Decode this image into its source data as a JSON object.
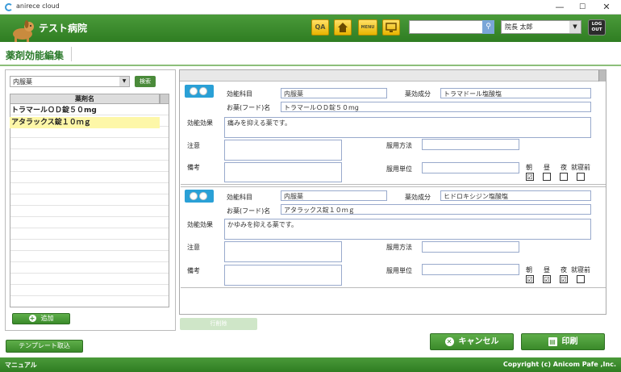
{
  "window": {
    "title": "anirece cloud",
    "minimize": "—",
    "maximize": "☐",
    "close": "✕"
  },
  "header": {
    "hospital_name": "テスト病院",
    "qa_label": "QA",
    "home_icon": "home-icon",
    "menu_label": "MENU",
    "monitor_icon": "monitor-icon",
    "search_value": "",
    "user_name": "院長 太郎",
    "logout_label_1": "LOG",
    "logout_label_2": "OUT"
  },
  "page": {
    "title": "薬剤効能編集"
  },
  "left": {
    "kind_value": "内服薬",
    "search_button": "検索",
    "column_header": "薬剤名",
    "items": [
      {
        "label": "トラマールＯＤ錠５０mg",
        "selected": false
      },
      {
        "label": "アタラックス錠１０ｍｇ",
        "selected": true
      }
    ],
    "add_button": "追加",
    "template_button": "テンプレート取込"
  },
  "labels": {
    "subject": "効能科目",
    "ingredient": "薬効成分",
    "food_name": "お薬(フード)名",
    "effect": "効能効果",
    "caution": "注意",
    "usage": "服用方法",
    "note": "備考",
    "unit": "服用単位",
    "morning": "朝",
    "noon": "昼",
    "night": "夜",
    "bedtime": "就寝前"
  },
  "cards": [
    {
      "subject": "内服薬",
      "ingredient": "トラマドール塩酸塩",
      "food_name": "トラマールＯＤ錠５０mg",
      "effect": "痛みを抑える薬です。",
      "caution": "",
      "usage": "",
      "note": "",
      "unit": "",
      "morning": "☑",
      "noon": "",
      "night": "",
      "bedtime": ""
    },
    {
      "subject": "内服薬",
      "ingredient": "ヒドロキシジン塩酸塩",
      "food_name": "アタラックス錠１０ｍｇ",
      "effect": "かゆみを抑える薬です。",
      "caution": "",
      "usage": "",
      "note": "",
      "unit": "",
      "morning": "☑",
      "noon": "☑",
      "night": "☑",
      "bedtime": ""
    }
  ],
  "bottom": {
    "delete_row": "行削除",
    "cancel": "キャンセル",
    "print": "印刷"
  },
  "footer": {
    "manual": "マニュアル",
    "copyright": "Copyright (c) Anicom Pafe ,Inc."
  },
  "colors": {
    "brand_green": "#3a8a2a",
    "header_yellow": "#f0c419",
    "pill_blue": "#2aa0d6",
    "selected_row": "#fdf7a8"
  }
}
